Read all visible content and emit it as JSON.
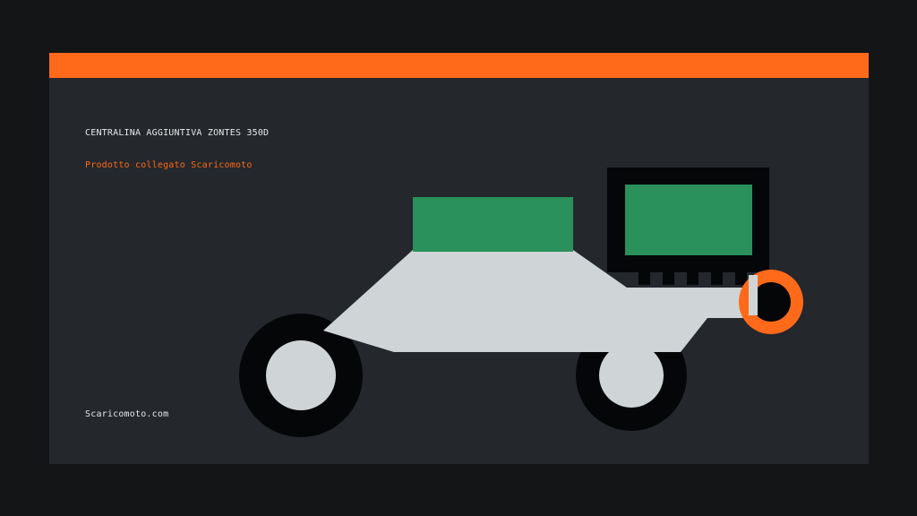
{
  "colors": {
    "background": "#141517",
    "card": "#24272c",
    "accent": "#ff6a1a",
    "body": "#cfd5d7",
    "screen": "#2a905c",
    "dark": "#050607"
  },
  "header": {
    "title": "CENTRALINA AGGIUNTIVA ZONTES 350D",
    "subtitle": "Prodotto collegato Scaricomoto"
  },
  "footer": {
    "text": "Scaricomoto.com"
  },
  "illustration": {
    "subject": "motorcycle-with-ecu-module",
    "icons": [
      "front-wheel-icon",
      "rear-wheel-icon",
      "ecu-module-icon",
      "orange-ring-icon"
    ]
  }
}
